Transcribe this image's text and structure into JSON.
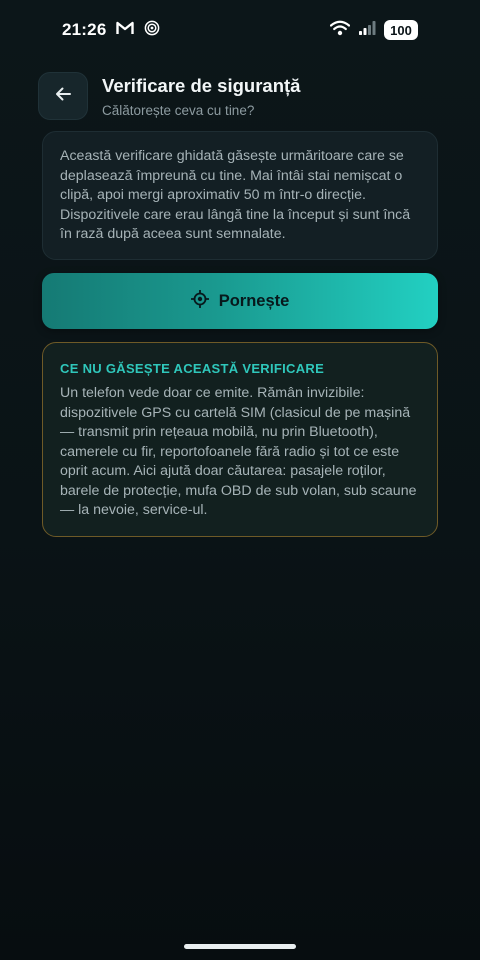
{
  "status_bar": {
    "time": "21:26",
    "battery": "100",
    "icons": [
      "gmail-icon",
      "hotspot-icon",
      "wifi-icon",
      "signal-icon",
      "battery-icon"
    ]
  },
  "header": {
    "back_icon": "arrow-left-icon",
    "title": "Verificare de siguranță",
    "subtitle": "Călătorește ceva cu tine?"
  },
  "info_card": {
    "text": "Această verificare ghidată găsește urmăritoare care se deplasează împreună cu tine. Mai întâi stai nemișcat o clipă, apoi mergi aproximativ 50 m într-o direcție. Dispozitivele care erau lângă tine la început și sunt încă în rază după aceea sunt semnalate."
  },
  "start_button": {
    "icon": "target-icon",
    "label": "Pornește"
  },
  "warning_card": {
    "title": "CE NU GĂSEȘTE ACEASTĂ VERIFICARE",
    "text": "Un telefon vede doar ce emite. Rămân invizibile: dispozitivele GPS cu cartelă SIM (clasicul de pe mașină — transmit prin rețeaua mobilă, nu prin Bluetooth), camerele cu fir, reportofoanele fără radio și tot ce este oprit acum. Aici ajută doar căutarea: pasajele roților, barele de protecție, mufa OBD de sub volan, sub scaune — la nevoie, service-ul."
  },
  "colors": {
    "background": "#0b1418",
    "accent": "#22d0c2",
    "warning_border": "#6e5a27"
  }
}
